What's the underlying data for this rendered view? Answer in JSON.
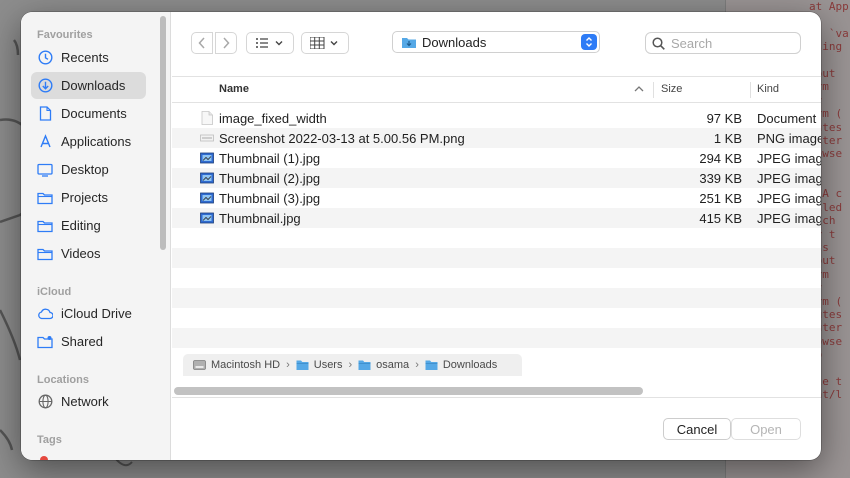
{
  "sidebar": {
    "favourites_heading": "Favourites",
    "favourites": [
      {
        "label": "Recents",
        "icon": "clock-icon"
      },
      {
        "label": "Downloads",
        "icon": "download-circle-icon",
        "active": true
      },
      {
        "label": "Documents",
        "icon": "document-icon"
      },
      {
        "label": "Applications",
        "icon": "applications-icon"
      },
      {
        "label": "Desktop",
        "icon": "desktop-icon"
      },
      {
        "label": "Projects",
        "icon": "folder-icon"
      },
      {
        "label": "Editing",
        "icon": "folder-icon"
      },
      {
        "label": "Videos",
        "icon": "folder-icon"
      }
    ],
    "icloud_heading": "iCloud",
    "icloud": [
      {
        "label": "iCloud Drive",
        "icon": "cloud-icon"
      },
      {
        "label": "Shared",
        "icon": "shared-folder-icon"
      }
    ],
    "locations_heading": "Locations",
    "locations": [
      {
        "label": "Network",
        "icon": "globe-icon"
      }
    ],
    "tags_heading": "Tags"
  },
  "toolbar": {
    "current_folder": "Downloads",
    "search_placeholder": "Search"
  },
  "columns": {
    "name": "Name",
    "size": "Size",
    "kind": "Kind"
  },
  "files": [
    {
      "name": "image_fixed_width",
      "size": "97 KB",
      "kind": "Document",
      "icon": "blank-document-icon"
    },
    {
      "name": "Screenshot 2022-03-13 at 5.00.56 PM.png",
      "size": "1 KB",
      "kind": "PNG image",
      "icon": "png-thumbnail-icon"
    },
    {
      "name": "Thumbnail (1).jpg",
      "size": "294 KB",
      "kind": "JPEG image",
      "icon": "jpeg-thumbnail-icon"
    },
    {
      "name": "Thumbnail (2).jpg",
      "size": "339 KB",
      "kind": "JPEG image",
      "icon": "jpeg-thumbnail-icon"
    },
    {
      "name": "Thumbnail (3).jpg",
      "size": "251 KB",
      "kind": "JPEG image",
      "icon": "jpeg-thumbnail-icon"
    },
    {
      "name": "Thumbnail.jpg",
      "size": "415 KB",
      "kind": "JPEG image",
      "icon": "jpeg-thumbnail-icon"
    }
  ],
  "pathbar": [
    "Macintosh HD",
    "Users",
    "osama",
    "Downloads"
  ],
  "buttons": {
    "cancel": "Cancel",
    "open": "Open"
  },
  "background_code": [
    "at App",
    "",
    "s: `va",
    "using",
    "s.",
    "nput",
    "orm",
    "iv",
    "orm (",
    "outes",
    "outer",
    "rowse",
    "P",
    "",
    ": A c",
    "alled",
    "hich",
    "or t",
    "nts",
    "nput",
    "orm",
    "iv",
    "orm (",
    "outes",
    "outer",
    "rowse",
    "pp",
    "",
    "lle t",
    "cat/l"
  ],
  "colors": {
    "accent": "#2e7cf6",
    "sidebar_bg": "#f4f4f4",
    "selection": "#dcdcdc"
  }
}
